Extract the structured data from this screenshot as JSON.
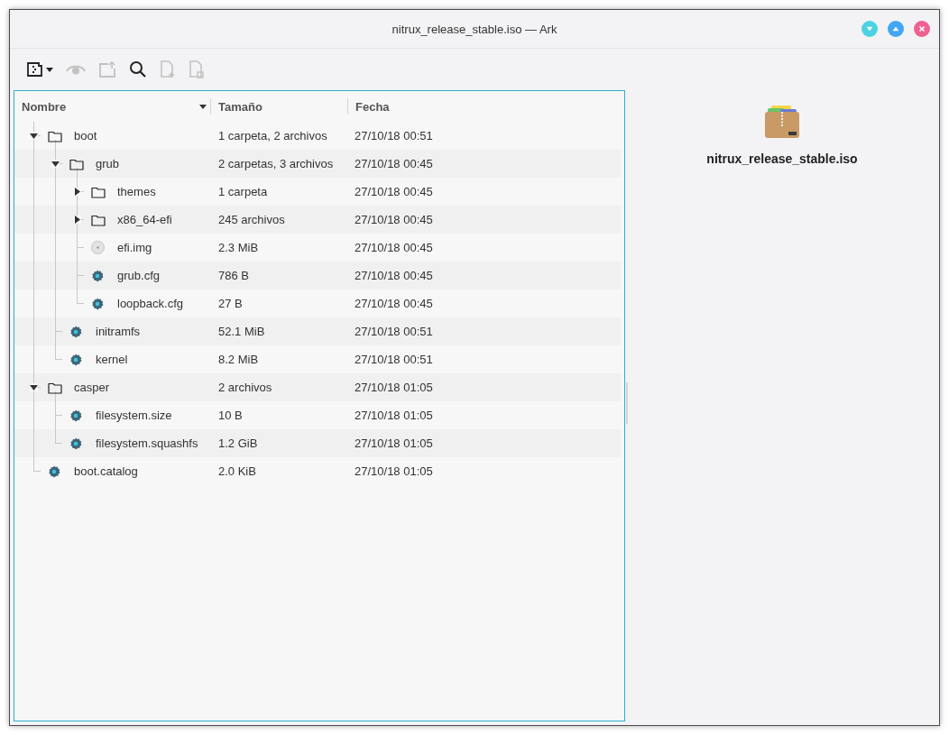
{
  "window": {
    "title": "nitrux_release_stable.iso — Ark",
    "buttons": [
      {
        "kind": "minimize"
      },
      {
        "kind": "maximize"
      },
      {
        "kind": "close"
      }
    ]
  },
  "toolbar": [
    {
      "kind": "new-archive",
      "disabled": false
    },
    {
      "kind": "preview",
      "disabled": true
    },
    {
      "kind": "extract",
      "disabled": true
    },
    {
      "kind": "search",
      "disabled": false
    },
    {
      "kind": "add-file",
      "disabled": true
    },
    {
      "kind": "delete-file",
      "disabled": true
    }
  ],
  "columns": [
    {
      "label": "Nombre",
      "sorted": true
    },
    {
      "label": "Tamaño",
      "sorted": false
    },
    {
      "label": "Fecha",
      "sorted": false
    }
  ],
  "tree": [
    {
      "name": "boot",
      "kind": "folder",
      "size": "1 carpeta, 2 archivos",
      "date": "27/10/18 00:51",
      "expanded": true,
      "children": [
        {
          "name": "grub",
          "kind": "folder",
          "size": "2 carpetas, 3 archivos",
          "date": "27/10/18 00:45",
          "expanded": true,
          "children": [
            {
              "name": "themes",
              "kind": "folder",
              "size": "1 carpeta",
              "date": "27/10/18 00:45",
              "expanded": false
            },
            {
              "name": "x86_64-efi",
              "kind": "folder",
              "size": "245 archivos",
              "date": "27/10/18 00:45",
              "expanded": false
            },
            {
              "name": "efi.img",
              "kind": "disc-image",
              "size": "2.3 MiB",
              "date": "27/10/18 00:45"
            },
            {
              "name": "grub.cfg",
              "kind": "config",
              "size": "786 B",
              "date": "27/10/18 00:45"
            },
            {
              "name": "loopback.cfg",
              "kind": "config",
              "size": "27 B",
              "date": "27/10/18 00:45"
            }
          ]
        },
        {
          "name": "initramfs",
          "kind": "config",
          "size": "52.1 MiB",
          "date": "27/10/18 00:51"
        },
        {
          "name": "kernel",
          "kind": "config",
          "size": "8.2 MiB",
          "date": "27/10/18 00:51"
        }
      ]
    },
    {
      "name": "casper",
      "kind": "folder",
      "size": "2 archivos",
      "date": "27/10/18 01:05",
      "expanded": true,
      "children": [
        {
          "name": "filesystem.size",
          "kind": "config",
          "size": "10 B",
          "date": "27/10/18 01:05"
        },
        {
          "name": "filesystem.squashfs",
          "kind": "config",
          "size": "1.2 GiB",
          "date": "27/10/18 01:05"
        }
      ]
    },
    {
      "name": "boot.catalog",
      "kind": "config",
      "size": "2.0 KiB",
      "date": "27/10/18 01:05"
    }
  ],
  "preview": {
    "filename": "nitrux_release_stable.iso"
  }
}
